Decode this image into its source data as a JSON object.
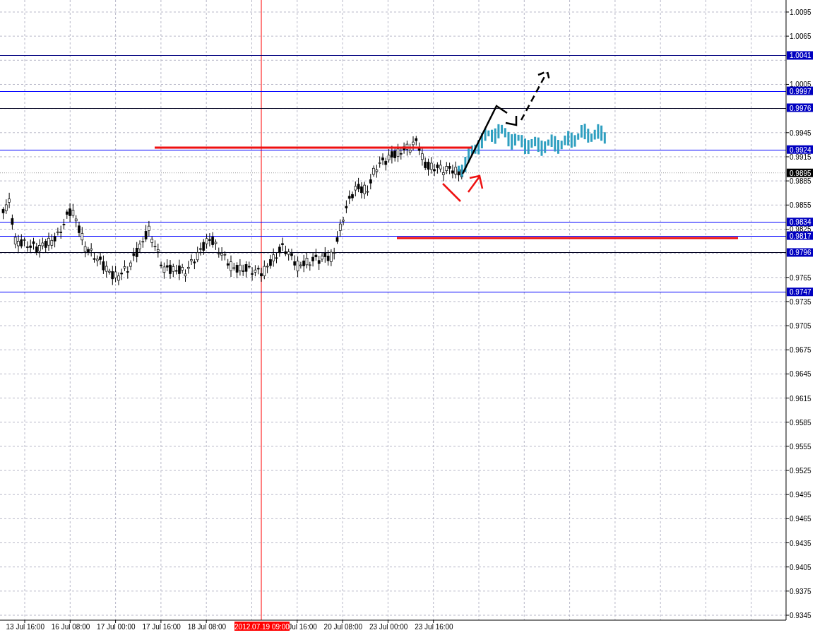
{
  "chart": {
    "price_axis": [
      "1.0095",
      "1.0065",
      "1.0005",
      "0.9945",
      "0.9915",
      "0.9885",
      "0.9855",
      "0.9825",
      "0.9765",
      "0.9735",
      "0.9705",
      "0.9675",
      "0.9645",
      "0.9615",
      "0.9585",
      "0.9555",
      "0.9525",
      "0.9495",
      "0.9465",
      "0.9435",
      "0.9405",
      "0.9375",
      "0.9345"
    ],
    "levels": [
      {
        "value": "1.0041",
        "color": "#000080"
      },
      {
        "value": "0.9997",
        "color": "#0000ff"
      },
      {
        "value": "0.9976",
        "color": "#000020"
      },
      {
        "value": "0.9924",
        "color": "#0000ff"
      },
      {
        "value": "0.9834",
        "color": "#0000ff"
      },
      {
        "value": "0.9817",
        "color": "#0000ff"
      },
      {
        "value": "0.9796",
        "color": "#000020"
      },
      {
        "value": "0.9747",
        "color": "#0000ff"
      }
    ],
    "current_price": "0.9895",
    "time_axis": [
      "13 Jul 16:00",
      "16 Jul 08:00",
      "17 Jul 00:00",
      "17 Jul 16:00",
      "18 Jul 08:00",
      "Jul 16:00",
      "20 Jul 08:00",
      "23 Jul 00:00",
      "23 Jul 16:00"
    ],
    "crosshair_time": "2012.07.19 09:00"
  }
}
